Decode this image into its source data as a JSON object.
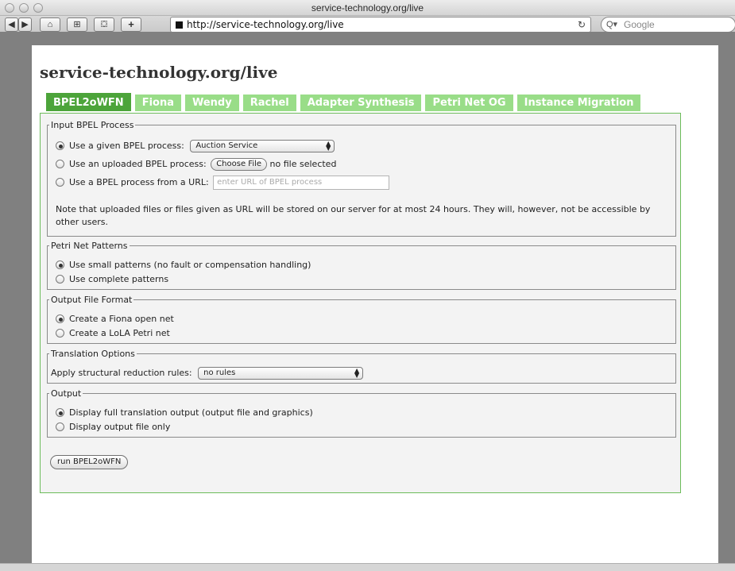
{
  "window": {
    "title": "service-technology.org/live"
  },
  "toolbar": {
    "back": "◀",
    "forward": "▶",
    "home": "⌂",
    "grid": "⊞",
    "bookmarks": "⛋",
    "add": "+",
    "url": "http://service-technology.org/live",
    "reload": "↻",
    "search_placeholder": "Google"
  },
  "page": {
    "site_title": "service-technology.org/live",
    "tabs": [
      "BPEL2oWFN",
      "Fiona",
      "Wendy",
      "Rachel",
      "Adapter Synthesis",
      "Petri Net OG",
      "Instance Migration"
    ],
    "input": {
      "legend": "Input BPEL Process",
      "opt_given": "Use a given BPEL process:",
      "given_value": "Auction Service",
      "opt_upload": "Use an uploaded BPEL process:",
      "choose_file": "Choose File",
      "no_file": "no file selected",
      "opt_url": "Use a BPEL process from a URL:",
      "url_placeholder": "enter URL of BPEL process",
      "note": "Note that uploaded files or files given as URL will be stored on our server for at most 24 hours. They will, however, not be accessible by other users."
    },
    "patterns": {
      "legend": "Petri Net Patterns",
      "opt_small": "Use small patterns (no fault or compensation handling)",
      "opt_complete": "Use complete patterns"
    },
    "format": {
      "legend": "Output File Format",
      "opt_fiona": "Create a Fiona open net",
      "opt_lola": "Create a LoLA Petri net"
    },
    "translation": {
      "legend": "Translation Options",
      "label": "Apply structural reduction rules:",
      "value": "no rules"
    },
    "output": {
      "legend": "Output",
      "opt_full": "Display full translation output (output file and graphics)",
      "opt_file": "Display output file only"
    },
    "run_button": "run BPEL2oWFN"
  }
}
